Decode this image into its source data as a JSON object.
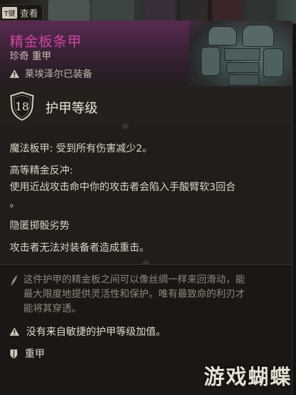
{
  "topbar": {
    "key": "T键",
    "action": "查看"
  },
  "item": {
    "name": "精金板条甲",
    "rarity_type": "珍奇 重甲",
    "equipped_by": "莱埃泽尔已装备",
    "name_color": "#d0469f"
  },
  "armor_class": {
    "value": "18",
    "label": "护甲等级"
  },
  "properties": {
    "line1": "魔法板甲: 受到所有伤害减少2。",
    "line2": "高等精金反冲:",
    "line3": "使用近战攻击命中你的攻击者会陷入手酸臂软3回合",
    "line4": "。",
    "line5": "隐匿掷骰劣势",
    "line6": "攻击者无法对装备者造成重击。"
  },
  "description": {
    "line1": "这件护甲的精金板之间可以像丝绸一样来回滑动，能",
    "line2": "最大限度地提供灵活性和保护。唯有最致命的利刃才",
    "line3": "能将其穿透。"
  },
  "notes": {
    "no_dex": "没有来自敏捷的护甲等级加值。",
    "armor_type": "重甲"
  },
  "watermark": "游戏蝴蝶",
  "icons": {
    "warning": "warning-icon",
    "shield": "shield-icon",
    "feather": "feather-icon",
    "armor": "armor-icon"
  }
}
